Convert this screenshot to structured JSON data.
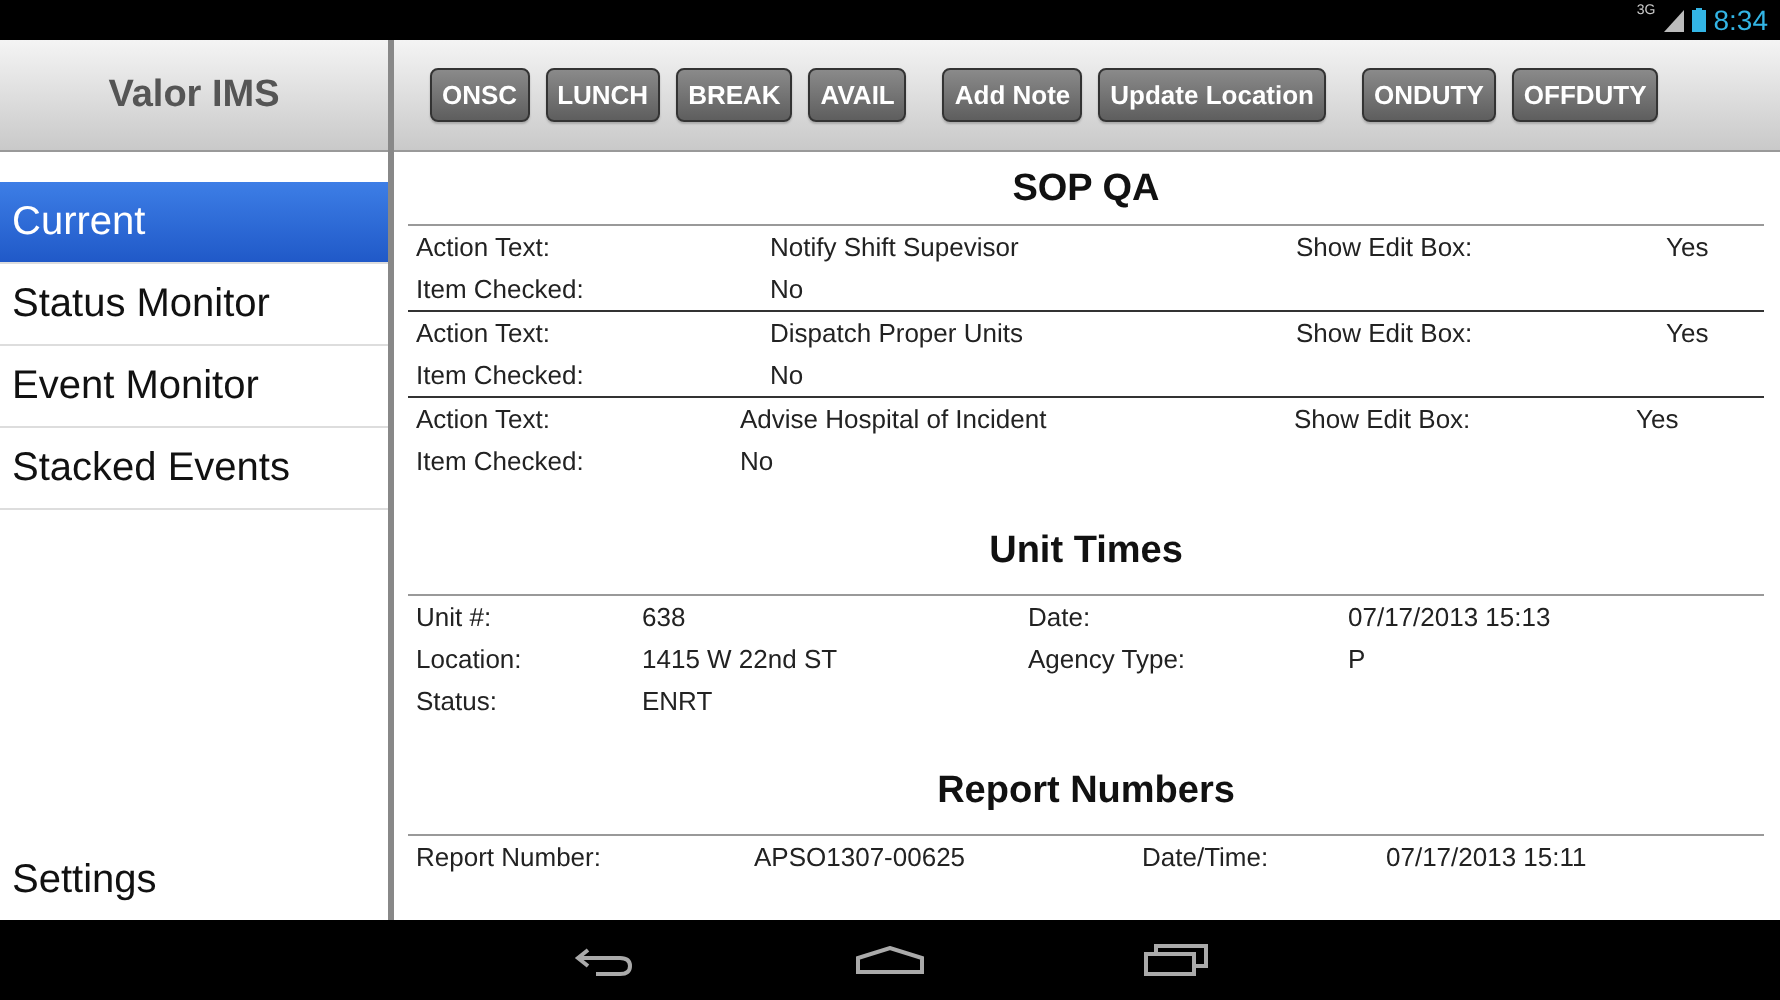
{
  "status_bar": {
    "network": "3G",
    "time": "8:34"
  },
  "app_title": "Valor IMS",
  "sidebar": {
    "items": [
      {
        "label": "Current",
        "selected": true
      },
      {
        "label": "Status Monitor",
        "selected": false
      },
      {
        "label": "Event Monitor",
        "selected": false
      },
      {
        "label": "Stacked Events",
        "selected": false
      }
    ],
    "footer": "Settings"
  },
  "toolbar": {
    "groups": [
      [
        "ONSC",
        "LUNCH",
        "BREAK",
        "AVAIL"
      ],
      [
        "Add Note",
        "Update Location"
      ],
      [
        "ONDUTY",
        "OFFDUTY"
      ]
    ]
  },
  "sop_qa": {
    "title": "SOP QA",
    "items": [
      {
        "action_label": "Action Text:",
        "action": "Notify Shift Supevisor",
        "edit_label": "Show Edit Box:",
        "edit": "Yes",
        "checked_label": "Item Checked:",
        "checked": "No"
      },
      {
        "action_label": "Action Text:",
        "action": "Dispatch Proper Units",
        "edit_label": "Show Edit Box:",
        "edit": "Yes",
        "checked_label": "Item Checked:",
        "checked": "No"
      },
      {
        "action_label": "Action Text:",
        "action": "Advise Hospital of Incident",
        "edit_label": "Show Edit Box:",
        "edit": "Yes",
        "checked_label": "Item Checked:",
        "checked": "No"
      }
    ]
  },
  "unit_times": {
    "title": "Unit Times",
    "rows": [
      [
        "Unit #:",
        "638",
        "Date:",
        "07/17/2013 15:13"
      ],
      [
        "Location:",
        "1415 W 22nd ST",
        "Agency Type:",
        "P"
      ],
      [
        "Status:",
        "ENRT"
      ]
    ]
  },
  "report_numbers": {
    "title": "Report Numbers",
    "rows": [
      [
        "Report Number:",
        "APSO1307-00625",
        "Date/Time:",
        "07/17/2013 15:11"
      ]
    ]
  }
}
